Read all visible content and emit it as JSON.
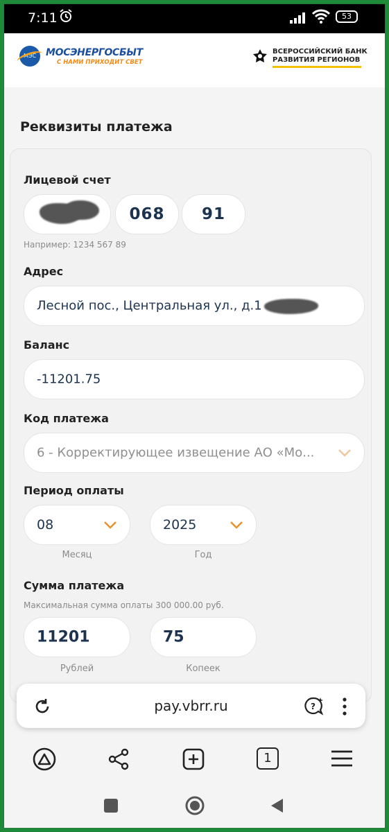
{
  "status_bar": {
    "time": "7:11",
    "battery": "53"
  },
  "header": {
    "mes_name": "МОСЭНЕРГОСБЫТ",
    "mes_slogan": "С НАМИ ПРИХОДИТ СВЕТ",
    "mes_logo_text": "МЭС",
    "bank_name_line1": "ВСЕРОССИЙСКИЙ БАНК",
    "bank_name_line2": "РАЗВИТИЯ РЕГИОНОВ"
  },
  "page_title": "Реквизиты платежа",
  "account": {
    "label": "Лицевой счет",
    "part2": "068",
    "part3": "91",
    "hint": "Например: 1234 567 89"
  },
  "address": {
    "label": "Адрес",
    "value": "Лесной пос., Центральная ул., д.1"
  },
  "balance": {
    "label": "Баланс",
    "value": "-11201.75"
  },
  "payment_code": {
    "label": "Код платежа",
    "value": "6 - Корректирующее извещение АО «Мо..."
  },
  "period": {
    "label": "Период оплаты",
    "month": "08",
    "month_caption": "Месяц",
    "year": "2025",
    "year_caption": "Год"
  },
  "amount": {
    "label": "Сумма платежа",
    "hint": "Максимальная сумма оплаты 300 000.00 руб.",
    "rubles": "11201",
    "rubles_caption": "Рублей",
    "kopecks": "75",
    "kopecks_caption": "Копеек"
  },
  "browser": {
    "url": "pay.vbrr.ru",
    "tab_count": "1"
  },
  "colors": {
    "accent_orange": "#e8922a",
    "text_dark_blue": "#1c3350",
    "mes_blue": "#1a4fa0",
    "vbrr_yellow": "#f2c200"
  }
}
